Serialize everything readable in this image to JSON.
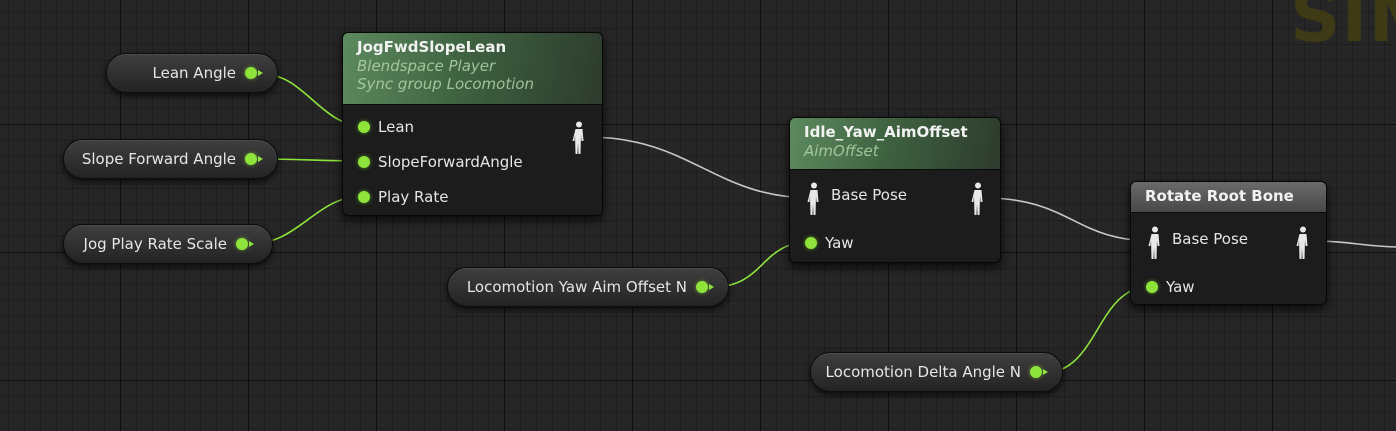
{
  "watermark": "SIM",
  "variables": {
    "lean_angle": "Lean Angle",
    "slope_forward_angle": "Slope Forward Angle",
    "jog_play_rate_scale": "Jog Play Rate Scale",
    "locomotion_yaw_aim_offset": "Locomotion Yaw Aim Offset N",
    "locomotion_delta_angle": "Locomotion Delta Angle N"
  },
  "nodes": {
    "blendspace": {
      "title": "JogFwdSlopeLean",
      "subtitle1": "Blendspace Player",
      "subtitle2": "Sync group Locomotion",
      "pins": [
        "Lean",
        "SlopeForwardAngle",
        "Play Rate"
      ]
    },
    "aim_offset": {
      "title": "Idle_Yaw_AimOffset",
      "subtitle": "AimOffset",
      "pins": [
        "Base Pose",
        "Yaw"
      ]
    },
    "rotate_root": {
      "title": "Rotate Root Bone",
      "pins": [
        "Base Pose",
        "Yaw"
      ]
    }
  },
  "colors": {
    "float_pin": "#8ee43a",
    "pose_wire": "#c8c8c8",
    "float_wire": "#8ee43a",
    "anim_header": "#4a7a4c",
    "grid_background": "#262626"
  }
}
